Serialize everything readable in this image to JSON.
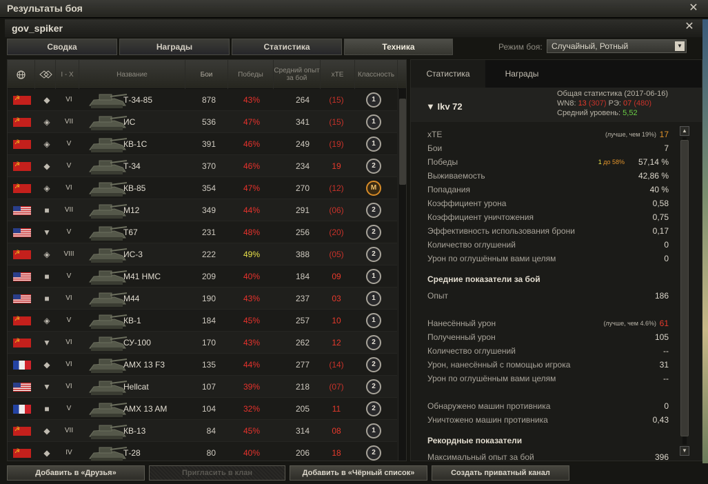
{
  "window": {
    "title": "Результаты боя",
    "player": "gov_spiker"
  },
  "tabs": [
    {
      "label": "Сводка"
    },
    {
      "label": "Награды"
    },
    {
      "label": "Статистика"
    },
    {
      "label": "Техника",
      "active": true
    }
  ],
  "mode": {
    "label": "Режим боя:",
    "value": "Случайный, Ротный"
  },
  "table": {
    "headers": {
      "nation": "",
      "type": "",
      "tier": "I - X",
      "name": "Название",
      "battles": "Бои",
      "wins": "Победы",
      "avg_exp": "Средний опыт за бой",
      "xte": "xTE",
      "mastery": "Классность"
    },
    "rows": [
      {
        "nation": "ussr",
        "type": "◆",
        "tier": "VI",
        "name": "Т-34-85",
        "battles": "878",
        "wins": "43%",
        "wins_color": "#e8322c",
        "avg": "264",
        "xte": "(15)",
        "xte_color": "#c8322a",
        "mastery": "1"
      },
      {
        "nation": "ussr",
        "type": "◈",
        "tier": "VII",
        "name": "ИС",
        "battles": "536",
        "wins": "47%",
        "wins_color": "#e8322c",
        "avg": "341",
        "xte": "(15)",
        "xte_color": "#c8322a",
        "mastery": "1"
      },
      {
        "nation": "ussr",
        "type": "◈",
        "tier": "V",
        "name": "КВ-1С",
        "battles": "391",
        "wins": "46%",
        "wins_color": "#e8322c",
        "avg": "249",
        "xte": "(19)",
        "xte_color": "#c8322a",
        "mastery": "1"
      },
      {
        "nation": "ussr",
        "type": "◆",
        "tier": "V",
        "name": "Т-34",
        "battles": "370",
        "wins": "46%",
        "wins_color": "#e8322c",
        "avg": "234",
        "xte": "19",
        "xte_color": "#e83a2c",
        "mastery": "2"
      },
      {
        "nation": "ussr",
        "type": "◈",
        "tier": "VI",
        "name": "КВ-85",
        "battles": "354",
        "wins": "47%",
        "wins_color": "#e8322c",
        "avg": "270",
        "xte": "(12)",
        "xte_color": "#c8322a",
        "mastery": "M"
      },
      {
        "nation": "usa",
        "type": "■",
        "tier": "VII",
        "name": "M12",
        "battles": "349",
        "wins": "44%",
        "wins_color": "#e8322c",
        "avg": "291",
        "xte": "(06)",
        "xte_color": "#c8322a",
        "mastery": "2"
      },
      {
        "nation": "usa",
        "type": "▼",
        "tier": "V",
        "name": "T67",
        "battles": "231",
        "wins": "48%",
        "wins_color": "#e8322c",
        "avg": "256",
        "xte": "(20)",
        "xte_color": "#c8322a",
        "mastery": "2"
      },
      {
        "nation": "ussr",
        "type": "◈",
        "tier": "VIII",
        "name": "ИС-3",
        "battles": "222",
        "wins": "49%",
        "wins_color": "#e8e04a",
        "avg": "388",
        "xte": "(05)",
        "xte_color": "#c8322a",
        "mastery": "2"
      },
      {
        "nation": "usa",
        "type": "■",
        "tier": "V",
        "name": "M41 HMC",
        "battles": "209",
        "wins": "40%",
        "wins_color": "#e8322c",
        "avg": "184",
        "xte": "09",
        "xte_color": "#e83a2c",
        "mastery": "1"
      },
      {
        "nation": "usa",
        "type": "■",
        "tier": "VI",
        "name": "M44",
        "battles": "190",
        "wins": "43%",
        "wins_color": "#e8322c",
        "avg": "237",
        "xte": "03",
        "xte_color": "#e83a2c",
        "mastery": "1"
      },
      {
        "nation": "ussr",
        "type": "◈",
        "tier": "V",
        "name": "КВ-1",
        "battles": "184",
        "wins": "45%",
        "wins_color": "#e8322c",
        "avg": "257",
        "xte": "10",
        "xte_color": "#e83a2c",
        "mastery": "1"
      },
      {
        "nation": "ussr",
        "type": "▼",
        "tier": "VI",
        "name": "СУ-100",
        "battles": "170",
        "wins": "43%",
        "wins_color": "#e8322c",
        "avg": "262",
        "xte": "12",
        "xte_color": "#e83a2c",
        "mastery": "2"
      },
      {
        "nation": "france",
        "type": "◆",
        "tier": "VI",
        "name": "AMX 13 F3",
        "battles": "135",
        "wins": "44%",
        "wins_color": "#e8322c",
        "avg": "277",
        "xte": "(14)",
        "xte_color": "#c8322a",
        "mastery": "2"
      },
      {
        "nation": "usa",
        "type": "▼",
        "tier": "VI",
        "name": "Hellcat",
        "battles": "107",
        "wins": "39%",
        "wins_color": "#e8322c",
        "avg": "218",
        "xte": "(07)",
        "xte_color": "#c8322a",
        "mastery": "2"
      },
      {
        "nation": "france",
        "type": "■",
        "tier": "V",
        "name": "AMX 13 AM",
        "battles": "104",
        "wins": "32%",
        "wins_color": "#e8322c",
        "avg": "205",
        "xte": "11",
        "xte_color": "#e83a2c",
        "mastery": "2"
      },
      {
        "nation": "ussr",
        "type": "◆",
        "tier": "VII",
        "name": "КВ-13",
        "battles": "84",
        "wins": "45%",
        "wins_color": "#e8322c",
        "avg": "314",
        "xte": "08",
        "xte_color": "#e83a2c",
        "mastery": "1"
      },
      {
        "nation": "ussr",
        "type": "◆",
        "tier": "IV",
        "name": "Т-28",
        "battles": "80",
        "wins": "40%",
        "wins_color": "#e8322c",
        "avg": "206",
        "xte": "18",
        "xte_color": "#e83a2c",
        "mastery": "2"
      }
    ]
  },
  "right": {
    "tabs": [
      {
        "label": "Статистика",
        "active": true
      },
      {
        "label": "Награды"
      }
    ],
    "tank": "Ikv 72",
    "general": {
      "line1": "Общая статистика (2017-06-16)",
      "wn8_label": "WN8:",
      "wn8": "13",
      "wn8_b": "(307)",
      "re_label": "РЭ:",
      "re": "07",
      "re_b": "(480)",
      "lvl_label": "Средний уровень:",
      "lvl": "5,52"
    },
    "stats": [
      {
        "label": "xTE",
        "note": "(лучше, чем 19%)",
        "value": "17",
        "value_color": "#e0922a"
      },
      {
        "label": "Бои",
        "value": "7"
      },
      {
        "label": "Победы",
        "note_a": "1",
        "note_b": "до 58%",
        "value": "57,14 %"
      },
      {
        "label": "Выживаемость",
        "value": "42,86 %"
      },
      {
        "label": "Попадания",
        "value": "40 %"
      },
      {
        "label": "Коэффициент урона",
        "value": "0,58"
      },
      {
        "label": "Коэффициент уничтожения",
        "value": "0,75"
      },
      {
        "label": "Эффективность использования брони",
        "value": "0,17"
      },
      {
        "label": "Количество оглушений",
        "value": "0"
      },
      {
        "label": "Урон по оглушённым вами целям",
        "value": "0"
      },
      {
        "label": "Средние показатели за бой",
        "header": true
      },
      {
        "label": "Опыт",
        "value": "186"
      },
      {
        "label": "Нанесённый урон",
        "note": "(лучше, чем 4.6%)",
        "value": "61",
        "value_color": "#e83a2c"
      },
      {
        "label": "Полученный урон",
        "value": "105"
      },
      {
        "label": "Количество оглушений",
        "value": "--"
      },
      {
        "label": "Урон, нанесённый с помощью игрока",
        "value": "31"
      },
      {
        "label": "Урон по оглушённым вами целям",
        "value": "--"
      },
      {
        "label": "Обнаружено машин противника",
        "value": "0"
      },
      {
        "label": "Уничтожено машин противника",
        "value": "0,43"
      },
      {
        "label": "Рекордные показатели",
        "header": true
      },
      {
        "label": "Максимальный опыт за бой",
        "value": "396"
      }
    ]
  },
  "buttons": [
    {
      "label": "Добавить в «Друзья»"
    },
    {
      "label": "Пригласить в клан",
      "disabled": true
    },
    {
      "label": "Добавить в «Чёрный список»"
    },
    {
      "label": "Создать приватный канал"
    }
  ],
  "colors": {
    "accent_green": "#6bd046",
    "red": "#e8322c",
    "orange": "#e0922a"
  }
}
